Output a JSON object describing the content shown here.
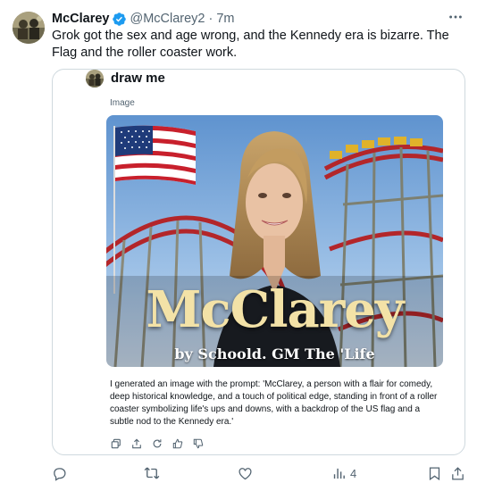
{
  "author": {
    "display_name": "McClarey",
    "handle": "@McClarey2",
    "time": "7m",
    "separator": "·"
  },
  "tweet": {
    "text": "Grok got the sex and age wrong, and the Kennedy era is bizarre.  The Flag and the roller coaster work."
  },
  "quote": {
    "title": "draw me",
    "image_label": "Image",
    "image": {
      "overlay_title": "McClarey",
      "overlay_subtitle": "by Schoold. GM The 'Life"
    },
    "response_text": "I generated an image with the prompt: 'McClarey, a person with a flair for comedy, deep historical knowledge, and a touch of political edge, standing in front of a roller coaster symbolizing life's ups and downs, with a backdrop of the US flag and a subtle nod to the Kennedy era.'",
    "actions": [
      "copy-icon",
      "share-icon",
      "regenerate-icon",
      "thumbs-up-icon",
      "thumbs-down-icon"
    ]
  },
  "actions": {
    "reply_icon": "reply-icon",
    "retweet_icon": "retweet-icon",
    "like_icon": "like-icon",
    "views_icon": "views-icon",
    "views_count": "4",
    "bookmark_icon": "bookmark-icon",
    "share_icon": "share-icon"
  },
  "colors": {
    "text": "#0f1419",
    "secondary": "#536471",
    "verified": "#1d9bf0",
    "border": "#cfd9de"
  }
}
